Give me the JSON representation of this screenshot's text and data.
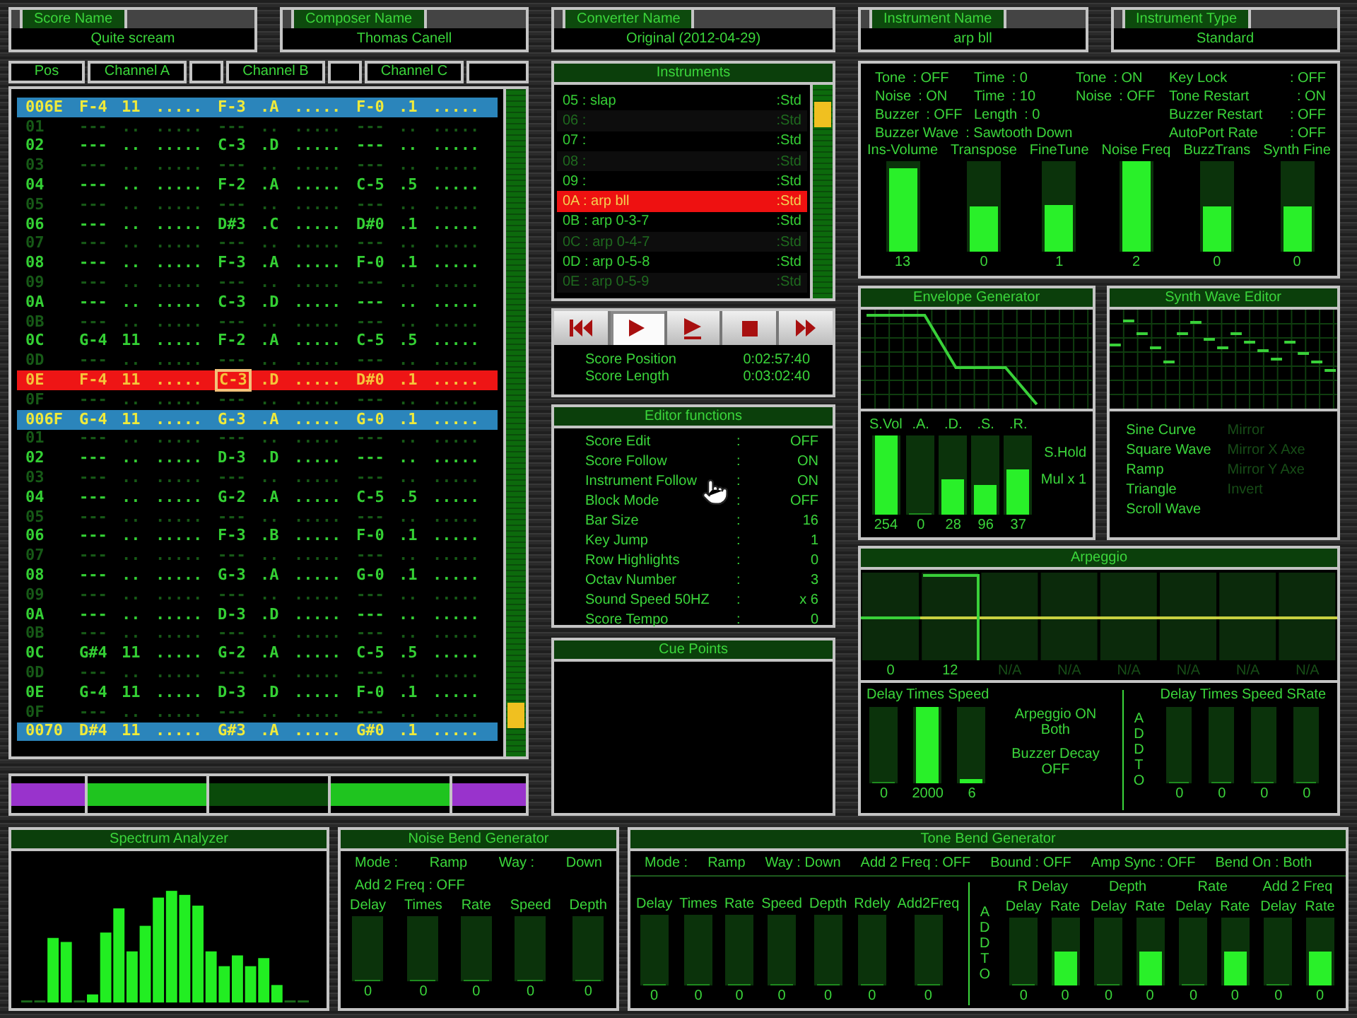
{
  "score_fields": [
    {
      "label": "Score Name",
      "value": "Quite scream"
    },
    {
      "label": "Composer Name",
      "value": "Thomas Canell"
    }
  ],
  "converter_field": {
    "label": "Converter Name",
    "value": "Original (2012-04-29)"
  },
  "instrument_fields": [
    {
      "label": "Instrument Name",
      "value": "arp bll"
    },
    {
      "label": "Instrument Type",
      "value": "Standard"
    }
  ],
  "tracker": {
    "header_tabs": [
      "Pos",
      "Channel A",
      "Channel B",
      "Channel C"
    ],
    "rows": [
      {
        "kind": "bar",
        "cells": [
          "006E",
          "F-4",
          "11",
          ".....",
          "F-3",
          ".A",
          ".....",
          "F-0",
          ".1",
          "....."
        ]
      },
      {
        "kind": "dim",
        "cells": [
          "01",
          "---",
          "..",
          ".....",
          "---",
          "..",
          ".....",
          "---",
          "..",
          "....."
        ]
      },
      {
        "kind": "normal",
        "cells": [
          "02",
          "---",
          "..",
          ".....",
          "C-3",
          ".D",
          ".....",
          "---",
          "..",
          "....."
        ]
      },
      {
        "kind": "dim",
        "cells": [
          "03",
          "---",
          "..",
          ".....",
          "---",
          "..",
          ".....",
          "---",
          "..",
          "....."
        ]
      },
      {
        "kind": "normal",
        "cells": [
          "04",
          "---",
          "..",
          ".....",
          "F-2",
          ".A",
          ".....",
          "C-5",
          ".5",
          "....."
        ]
      },
      {
        "kind": "dim",
        "cells": [
          "05",
          "---",
          "..",
          ".....",
          "---",
          "..",
          ".....",
          "---",
          "..",
          "....."
        ]
      },
      {
        "kind": "normal",
        "cells": [
          "06",
          "---",
          "..",
          ".....",
          "D#3",
          ".C",
          ".....",
          "D#0",
          ".1",
          "....."
        ]
      },
      {
        "kind": "dim",
        "cells": [
          "07",
          "---",
          "..",
          ".....",
          "---",
          "..",
          ".....",
          "---",
          "..",
          "....."
        ]
      },
      {
        "kind": "normal",
        "cells": [
          "08",
          "---",
          "..",
          ".....",
          "F-3",
          ".A",
          ".....",
          "F-0",
          ".1",
          "....."
        ]
      },
      {
        "kind": "dim",
        "cells": [
          "09",
          "---",
          "..",
          ".....",
          "---",
          "..",
          ".....",
          "---",
          "..",
          "....."
        ]
      },
      {
        "kind": "normal",
        "cells": [
          "0A",
          "---",
          "..",
          ".....",
          "C-3",
          ".D",
          ".....",
          "---",
          "..",
          "....."
        ]
      },
      {
        "kind": "dim",
        "cells": [
          "0B",
          "---",
          "..",
          ".....",
          "---",
          "..",
          ".....",
          "---",
          "..",
          "....."
        ]
      },
      {
        "kind": "normal",
        "cells": [
          "0C",
          "G-4",
          "11",
          ".....",
          "F-2",
          ".A",
          ".....",
          "C-5",
          ".5",
          "....."
        ]
      },
      {
        "kind": "dim",
        "cells": [
          "0D",
          "---",
          "..",
          ".....",
          "---",
          "..",
          ".....",
          "---",
          "..",
          "....."
        ]
      },
      {
        "kind": "current",
        "cursor_cells": [
          false,
          false,
          false,
          false,
          true,
          false,
          false,
          false,
          false,
          false
        ],
        "cells": [
          "0E",
          "F-4",
          "11",
          ".....",
          "C-3",
          ".D",
          ".....",
          "D#0",
          ".1",
          "....."
        ]
      },
      {
        "kind": "dim",
        "cells": [
          "0F",
          "---",
          "..",
          ".....",
          "---",
          "..",
          ".....",
          "---",
          "..",
          "....."
        ]
      },
      {
        "kind": "bar",
        "cells": [
          "006F",
          "G-4",
          "11",
          ".....",
          "G-3",
          ".A",
          ".....",
          "G-0",
          ".1",
          "....."
        ]
      },
      {
        "kind": "dim",
        "cells": [
          "01",
          "---",
          "..",
          ".....",
          "---",
          "..",
          ".....",
          "---",
          "..",
          "....."
        ]
      },
      {
        "kind": "normal",
        "cells": [
          "02",
          "---",
          "..",
          ".....",
          "D-3",
          ".D",
          ".....",
          "---",
          "..",
          "....."
        ]
      },
      {
        "kind": "dim",
        "cells": [
          "03",
          "---",
          "..",
          ".....",
          "---",
          "..",
          ".....",
          "---",
          "..",
          "....."
        ]
      },
      {
        "kind": "normal",
        "cells": [
          "04",
          "---",
          "..",
          ".....",
          "G-2",
          ".A",
          ".....",
          "C-5",
          ".5",
          "....."
        ]
      },
      {
        "kind": "dim",
        "cells": [
          "05",
          "---",
          "..",
          ".....",
          "---",
          "..",
          ".....",
          "---",
          "..",
          "....."
        ]
      },
      {
        "kind": "normal",
        "cells": [
          "06",
          "---",
          "..",
          ".....",
          "F-3",
          ".B",
          ".....",
          "F-0",
          ".1",
          "....."
        ]
      },
      {
        "kind": "dim",
        "cells": [
          "07",
          "---",
          "..",
          ".....",
          "---",
          "..",
          ".....",
          "---",
          "..",
          "....."
        ]
      },
      {
        "kind": "normal",
        "cells": [
          "08",
          "---",
          "..",
          ".....",
          "G-3",
          ".A",
          ".....",
          "G-0",
          ".1",
          "....."
        ]
      },
      {
        "kind": "dim",
        "cells": [
          "09",
          "---",
          "..",
          ".....",
          "---",
          "..",
          ".....",
          "---",
          "..",
          "....."
        ]
      },
      {
        "kind": "normal",
        "cells": [
          "0A",
          "---",
          "..",
          ".....",
          "D-3",
          ".D",
          ".....",
          "---",
          "..",
          "....."
        ]
      },
      {
        "kind": "dim",
        "cells": [
          "0B",
          "---",
          "..",
          ".....",
          "---",
          "..",
          ".....",
          "---",
          "..",
          "....."
        ]
      },
      {
        "kind": "normal",
        "cells": [
          "0C",
          "G#4",
          "11",
          ".....",
          "G-2",
          ".A",
          ".....",
          "C-5",
          ".5",
          "....."
        ]
      },
      {
        "kind": "dim",
        "cells": [
          "0D",
          "---",
          "..",
          ".....",
          "---",
          "..",
          ".....",
          "---",
          "..",
          "....."
        ]
      },
      {
        "kind": "normal",
        "cells": [
          "0E",
          "G-4",
          "11",
          ".....",
          "D-3",
          ".D",
          ".....",
          "F-0",
          ".1",
          "....."
        ]
      },
      {
        "kind": "dim",
        "cells": [
          "0F",
          "---",
          "..",
          ".....",
          "---",
          "..",
          ".....",
          "---",
          "..",
          "....."
        ]
      },
      {
        "kind": "bar",
        "cells": [
          "0070",
          "D#4",
          "11",
          ".....",
          "G#3",
          ".A",
          ".....",
          "G#0",
          ".1",
          "....."
        ]
      }
    ]
  },
  "channel_meters": [
    {
      "color": "#9933cc"
    },
    {
      "color": "#1fc41f"
    },
    {
      "color": "#0a4a0a"
    },
    {
      "color": "#1fc41f"
    },
    {
      "color": "#9933cc"
    }
  ],
  "instruments": {
    "title": "Instruments",
    "items": [
      {
        "label": "05 : slap",
        "type": ":Std",
        "selected": false,
        "dim": false
      },
      {
        "label": "06 :",
        "type": ":Std",
        "selected": false,
        "dim": true
      },
      {
        "label": "07 :",
        "type": ":Std",
        "selected": false,
        "dim": false
      },
      {
        "label": "08 :",
        "type": ":Std",
        "selected": false,
        "dim": true
      },
      {
        "label": "09 :",
        "type": ":Std",
        "selected": false,
        "dim": false
      },
      {
        "label": "0A : arp bll",
        "type": ":Std",
        "selected": true,
        "dim": false
      },
      {
        "label": "0B : arp 0-3-7",
        "type": ":Std",
        "selected": false,
        "dim": false
      },
      {
        "label": "0C : arp 0-4-7",
        "type": ":Std",
        "selected": false,
        "dim": true
      },
      {
        "label": "0D : arp 0-5-8",
        "type": ":Std",
        "selected": false,
        "dim": false
      },
      {
        "label": "0E : arp 0-5-9",
        "type": ":Std",
        "selected": false,
        "dim": true
      }
    ]
  },
  "transport": {
    "buttons": [
      {
        "kind": "rewind",
        "selected": false
      },
      {
        "kind": "play",
        "selected": true
      },
      {
        "kind": "play_pattern",
        "selected": false
      },
      {
        "kind": "stop",
        "selected": false
      },
      {
        "kind": "forward",
        "selected": false
      }
    ],
    "readouts": [
      {
        "label": "Score Position",
        "value": "0:02:57:40"
      },
      {
        "label": "Score Length",
        "value": "0:03:02:40"
      }
    ]
  },
  "editor": {
    "title": "Editor functions",
    "rows": [
      {
        "label": "Score Edit",
        "sep": ":",
        "value": "OFF"
      },
      {
        "label": "Score Follow",
        "sep": ":",
        "value": "ON"
      },
      {
        "label": "Instrument Follow",
        "sep": ":",
        "value": "ON"
      },
      {
        "label": "Block Mode",
        "sep": ":",
        "value": "OFF"
      },
      {
        "label": "Bar Size",
        "sep": ":",
        "value": "16"
      },
      {
        "label": "Key Jump",
        "sep": ":",
        "value": "1"
      },
      {
        "label": "Row Highlights",
        "sep": ":",
        "value": "0"
      },
      {
        "label": "Octav Number",
        "sep": ":",
        "value": "3"
      },
      {
        "label": "Sound Speed 50HZ",
        "sep": ":",
        "value": "x 6"
      },
      {
        "label": "Score Tempo",
        "sep": ":",
        "value": "0"
      }
    ]
  },
  "cue_points": {
    "title": "Cue Points"
  },
  "instrument_params": {
    "columns": [
      [
        {
          "label": "Tone",
          "value": ": OFF"
        },
        {
          "label": "Noise",
          "value": ": ON"
        },
        {
          "label": "Buzzer",
          "value": ": OFF"
        },
        {
          "label": "Buzzer Wave",
          "value": ": Sawtooth Down"
        }
      ],
      [
        {
          "label": "Time",
          "value": ": 0"
        },
        {
          "label": "Time",
          "value": ": 10"
        },
        {
          "label": "Length",
          "value": ": 0"
        }
      ],
      [
        {
          "label": "Tone",
          "value": ": ON"
        },
        {
          "label": "Noise",
          "value": ": OFF"
        }
      ],
      [
        {
          "label": "Key Lock",
          "value": ": OFF"
        },
        {
          "label": "Tone Restart",
          "value": ": ON"
        },
        {
          "label": "Buzzer Restart",
          "value": ": OFF"
        },
        {
          "label": "AutoPort Rate",
          "value": ": OFF"
        }
      ]
    ],
    "sliders": [
      {
        "label": "Ins-Volume",
        "value": "13",
        "level": 0.92
      },
      {
        "label": "Transpose",
        "value": "0",
        "level": 0.5
      },
      {
        "label": "FineTune",
        "value": "1",
        "level": 0.52
      },
      {
        "label": "Noise Freq",
        "value": "2",
        "level": 1
      },
      {
        "label": "BuzzTrans",
        "value": "0",
        "level": 0.5
      },
      {
        "label": "Synth Fine",
        "value": "0",
        "level": 0.5
      }
    ]
  },
  "envelope": {
    "title": "Envelope Generator",
    "sliders": [
      {
        "label": "S.Vol",
        "value": "254",
        "level": 1
      },
      {
        "label": ".A.",
        "value": "0",
        "level": 0
      },
      {
        "label": ".D.",
        "value": "28",
        "level": 0.44
      },
      {
        "label": ".S.",
        "value": "96",
        "level": 0.37
      },
      {
        "label": ".R.",
        "value": "37",
        "level": 0.58
      }
    ],
    "notes": [
      "S.Hold",
      "Mul x 1"
    ]
  },
  "synth_wave": {
    "title": "Synth Wave Editor",
    "options": [
      {
        "label": "Sine Curve",
        "disabled": false
      },
      {
        "label": "Square Wave",
        "disabled": false
      },
      {
        "label": "Ramp",
        "disabled": false
      },
      {
        "label": "Triangle",
        "disabled": false
      },
      {
        "label": "Scroll Wave",
        "disabled": false
      },
      {
        "label": "Mirror",
        "disabled": true
      },
      {
        "label": "Mirror X Axe",
        "disabled": true
      },
      {
        "label": "Mirror Y Axe",
        "disabled": true
      },
      {
        "label": "Invert",
        "disabled": true
      }
    ]
  },
  "arpeggio": {
    "title": "Arpeggio",
    "steps": [
      {
        "label": "0",
        "disabled": false
      },
      {
        "label": "12",
        "disabled": false
      },
      {
        "label": "N/A",
        "disabled": true
      },
      {
        "label": "N/A",
        "disabled": true
      },
      {
        "label": "N/A",
        "disabled": true
      },
      {
        "label": "N/A",
        "disabled": true
      },
      {
        "label": "N/A",
        "disabled": true
      },
      {
        "label": "N/A",
        "disabled": true
      }
    ],
    "left": {
      "header": "Delay Times Speed",
      "sliders": [
        {
          "value": "0",
          "level": 0
        },
        {
          "value": "2000",
          "level": 1
        },
        {
          "value": "6",
          "level": 0.05
        }
      ]
    },
    "notes": [
      "Arpeggio ON",
      "Both",
      "Buzzer Decay",
      "OFF"
    ],
    "add_to": "ADD TO",
    "right": {
      "header": "Delay Times Speed SRate",
      "sliders": [
        {
          "value": "0",
          "level": 0
        },
        {
          "value": "0",
          "level": 0
        },
        {
          "value": "0",
          "level": 0
        },
        {
          "value": "0",
          "level": 0
        }
      ]
    }
  },
  "spectrum": {
    "title": "Spectrum Analyzer"
  },
  "noise_bend": {
    "title": "Noise Bend Generator",
    "settings": [
      [
        "Mode :",
        "Ramp",
        "Way :",
        "Down"
      ],
      [
        "Add 2 Freq : OFF"
      ]
    ],
    "sliders": [
      {
        "label": "Delay",
        "value": "0",
        "level": 0
      },
      {
        "label": "Times",
        "value": "0",
        "level": 0
      },
      {
        "label": "Rate",
        "value": "0",
        "level": 0
      },
      {
        "label": "Speed",
        "value": "0",
        "level": 0
      },
      {
        "label": "Depth",
        "value": "0",
        "level": 0
      }
    ]
  },
  "tone_bend": {
    "title": "Tone Bend Generator",
    "settings": [
      "Mode :",
      "Ramp",
      "Way : Down",
      "Add 2 Freq : OFF",
      "Bound : OFF",
      "Amp Sync : OFF",
      "Bend On : Both"
    ],
    "sliders": [
      {
        "label": "Delay",
        "value": "0",
        "level": 0
      },
      {
        "label": "Times",
        "value": "0",
        "level": 0
      },
      {
        "label": "Rate",
        "value": "0",
        "level": 0
      },
      {
        "label": "Speed",
        "value": "0",
        "level": 0
      },
      {
        "label": "Depth",
        "value": "0",
        "level": 0
      },
      {
        "label": "Rdely",
        "value": "0",
        "level": 0
      },
      {
        "label": "Add2Freq",
        "value": "0",
        "level": 0
      }
    ],
    "add_to": "ADD TO",
    "groups": [
      {
        "label": "R Delay",
        "sliders": [
          {
            "label": "Delay",
            "value": "0",
            "level": 0
          },
          {
            "label": "Rate",
            "value": "0",
            "level": 0.5
          }
        ]
      },
      {
        "label": "Depth",
        "sliders": [
          {
            "label": "Delay",
            "value": "0",
            "level": 0
          },
          {
            "label": "Rate",
            "value": "0",
            "level": 0.5
          }
        ]
      },
      {
        "label": "Rate",
        "sliders": [
          {
            "label": "Delay",
            "value": "0",
            "level": 0
          },
          {
            "label": "Rate",
            "value": "0",
            "level": 0.5
          }
        ]
      },
      {
        "label": "Add 2 Freq",
        "sliders": [
          {
            "label": "Delay",
            "value": "0",
            "level": 0
          },
          {
            "label": "Rate",
            "value": "0",
            "level": 0.5
          }
        ]
      }
    ]
  }
}
